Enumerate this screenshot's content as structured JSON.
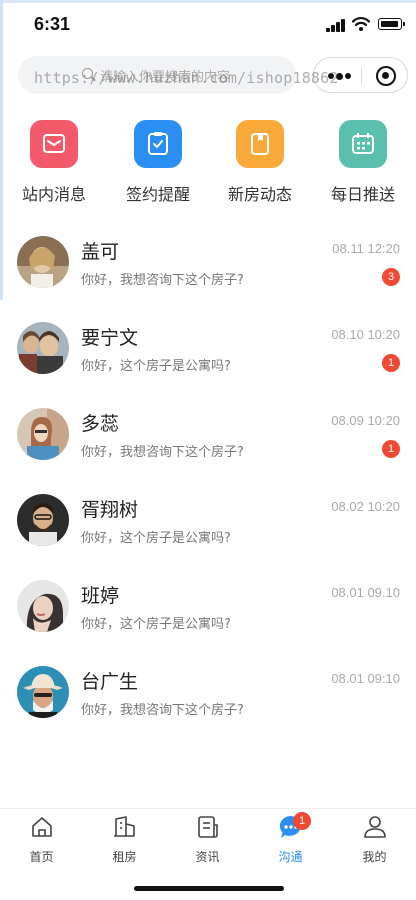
{
  "status_bar": {
    "time": "6:31"
  },
  "search": {
    "placeholder": "请输入你要搜索的内容"
  },
  "watermark": "https://www.huzhan.com/ishop18862",
  "categories": [
    {
      "label": "站内消息",
      "icon": "envelope-icon",
      "color": "#f25a6a"
    },
    {
      "label": "签约提醒",
      "icon": "checklist-icon",
      "color": "#2a8ef2"
    },
    {
      "label": "新房动态",
      "icon": "document-icon",
      "color": "#f8a93a"
    },
    {
      "label": "每日推送",
      "icon": "calendar-icon",
      "color": "#5bbfae"
    }
  ],
  "messages": [
    {
      "name": "盖可",
      "time": "08.11 12:20",
      "preview": "你好，我想咨询下这个房子?",
      "badge": "3"
    },
    {
      "name": "要宁文",
      "time": "08.10 10:20",
      "preview": "你好，这个房子是公寓吗?",
      "badge": "1"
    },
    {
      "name": "多蕊",
      "time": "08.09 10:20",
      "preview": "你好，我想咨询下这个房子?",
      "badge": "1"
    },
    {
      "name": "胥翔树",
      "time": "08.02 10:20",
      "preview": "你好，这个房子是公寓吗?",
      "badge": ""
    },
    {
      "name": "班婷",
      "time": "08.01 09.10",
      "preview": "你好，这个房子是公寓吗?",
      "badge": ""
    },
    {
      "name": "台广生",
      "time": "08.01 09:10",
      "preview": "你好，我想咨询下这个房子?",
      "badge": ""
    }
  ],
  "tabs": [
    {
      "label": "首页",
      "icon": "home-icon"
    },
    {
      "label": "租房",
      "icon": "building-icon"
    },
    {
      "label": "资讯",
      "icon": "news-icon"
    },
    {
      "label": "沟通",
      "icon": "chat-icon",
      "badge": "1",
      "active": true
    },
    {
      "label": "我的",
      "icon": "user-icon"
    }
  ],
  "colors": {
    "accent": "#2b8ef0",
    "badge": "#f04a35"
  }
}
